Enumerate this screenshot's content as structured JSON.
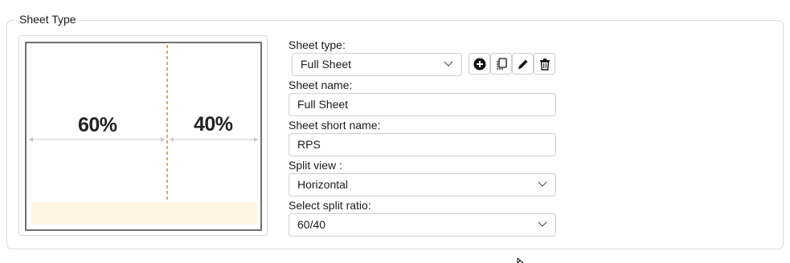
{
  "group": {
    "title": "Sheet Type"
  },
  "preview": {
    "left_pct_label": "60%",
    "right_pct_label": "40%",
    "split_ratio": [
      60,
      40
    ],
    "divider_color": "#d9864c",
    "footer_color": "#fdf4e2"
  },
  "form": {
    "sheet_type": {
      "label": "Sheet type:",
      "value": "Full Sheet"
    },
    "sheet_name": {
      "label": "Sheet name:",
      "value": "Full Sheet"
    },
    "sheet_short_name": {
      "label": "Sheet short name:",
      "value": "RPS"
    },
    "split_view": {
      "label": "Split view :",
      "value": "Horizontal"
    },
    "split_ratio": {
      "label": "Select split ratio:",
      "value": "60/40"
    }
  },
  "toolbar": {
    "icons": [
      "add-circle-icon",
      "copy-icon",
      "edit-pencil-icon",
      "trash-icon"
    ]
  }
}
